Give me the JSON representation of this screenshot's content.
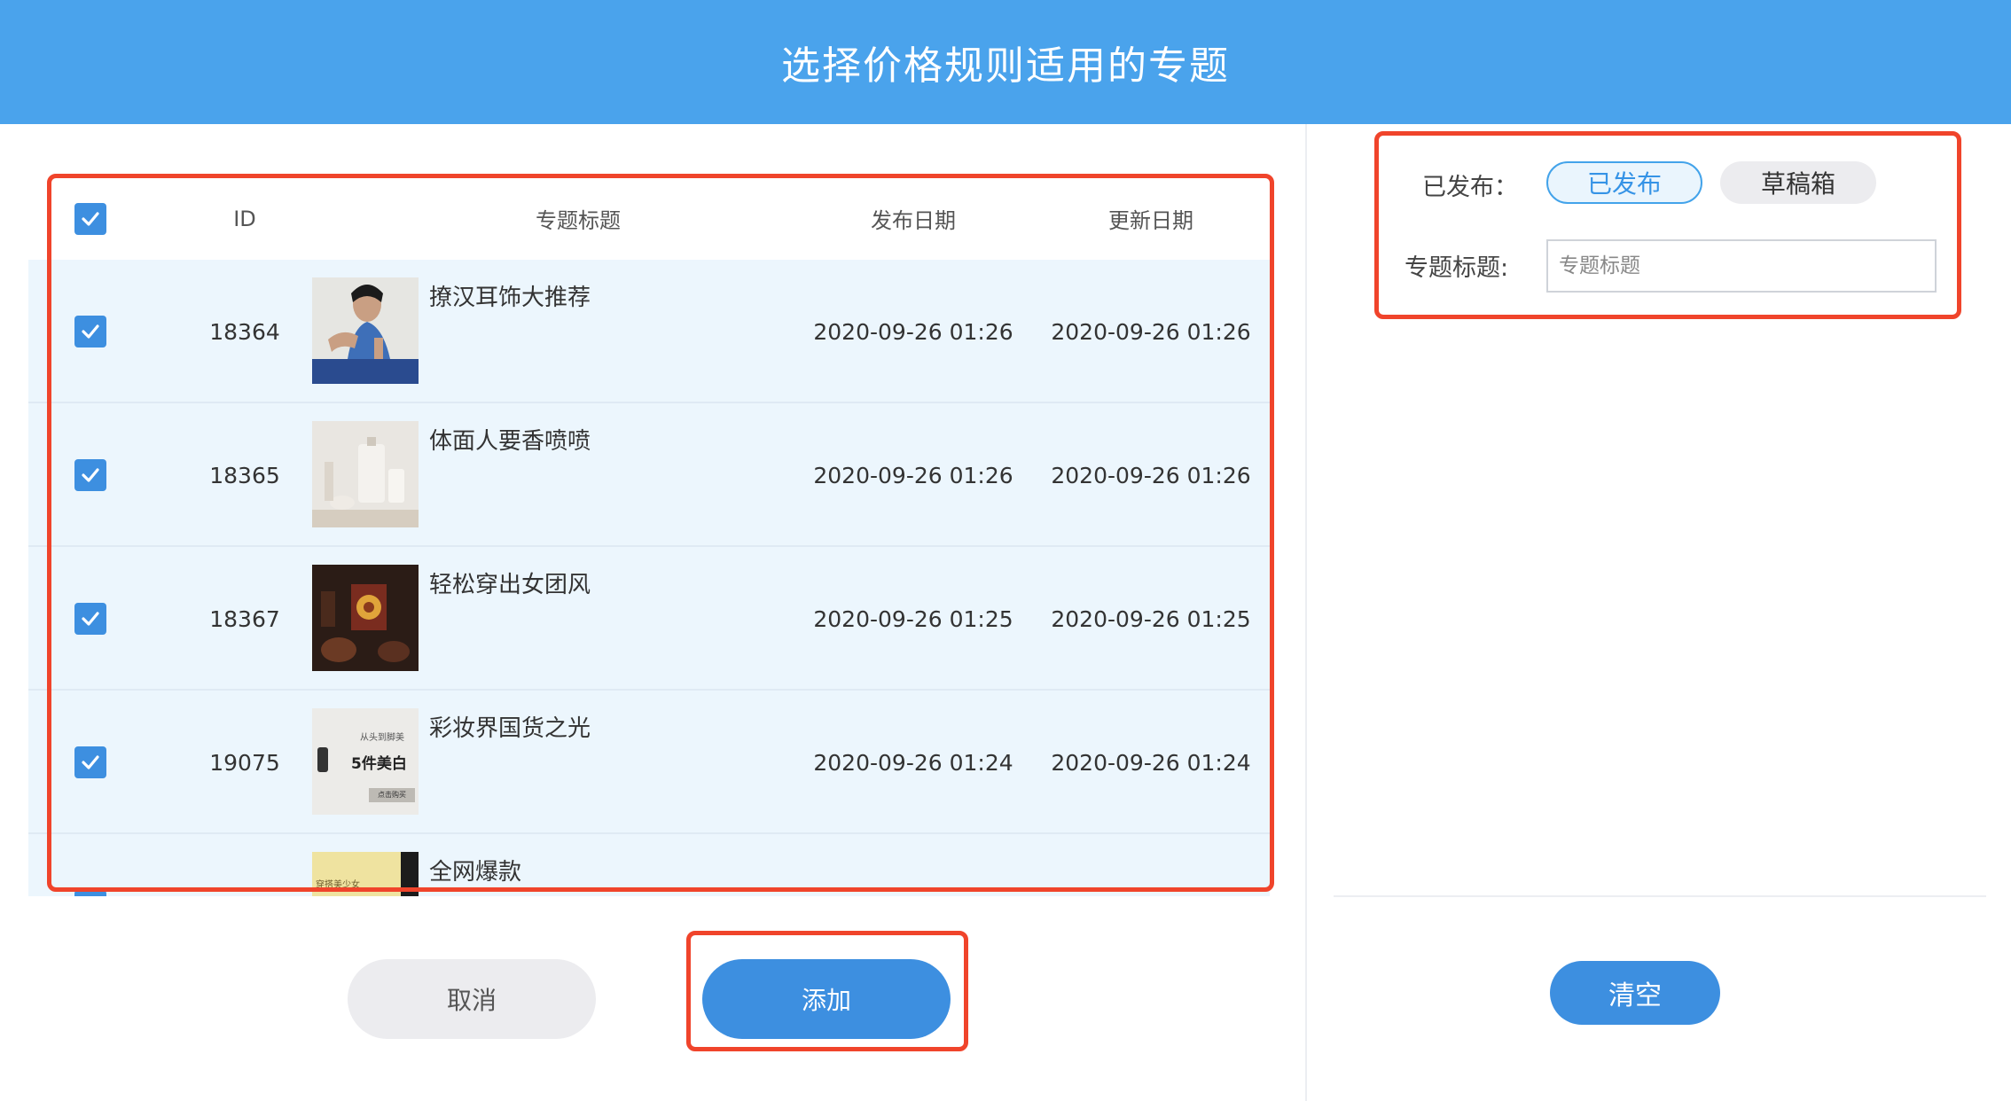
{
  "dialog": {
    "title": "选择价格规则适用的专题"
  },
  "table": {
    "headers": {
      "id": "ID",
      "title": "专题标题",
      "publish_date": "发布日期",
      "update_date": "更新日期"
    },
    "rows": [
      {
        "id": "18364",
        "title": "撩汉耳饰大推荐",
        "publish_date": "2020-09-26 01:26",
        "update_date": "2020-09-26 01:26",
        "checked": true
      },
      {
        "id": "18365",
        "title": "体面人要香喷喷",
        "publish_date": "2020-09-26 01:26",
        "update_date": "2020-09-26 01:26",
        "checked": true
      },
      {
        "id": "18367",
        "title": "轻松穿出女团风",
        "publish_date": "2020-09-26 01:25",
        "update_date": "2020-09-26 01:25",
        "checked": true
      },
      {
        "id": "19075",
        "title": "彩妆界国货之光",
        "publish_date": "2020-09-26 01:24",
        "update_date": "2020-09-26 01:24",
        "checked": true
      },
      {
        "id": "",
        "title": "全网爆款",
        "publish_date": "",
        "update_date": "",
        "checked": true
      }
    ],
    "thumb_texts": {
      "row4_small": "从头到脚美",
      "row4_big": "5件美白",
      "row4_tag": "点击购买",
      "row5_small": "穿搭美少女"
    }
  },
  "buttons": {
    "cancel": "取消",
    "add": "添加",
    "clear": "清空"
  },
  "filters": {
    "status_label": "已发布：",
    "status_options": [
      "已发布",
      "草稿箱"
    ],
    "status_selected": "已发布",
    "title_label": "专题标题:",
    "title_placeholder": "专题标题",
    "title_value": ""
  },
  "colors": {
    "header": "#4aa3ec",
    "primary": "#3d8fe0",
    "highlight": "#f0442b",
    "row_bg": "#ecf6fd"
  }
}
